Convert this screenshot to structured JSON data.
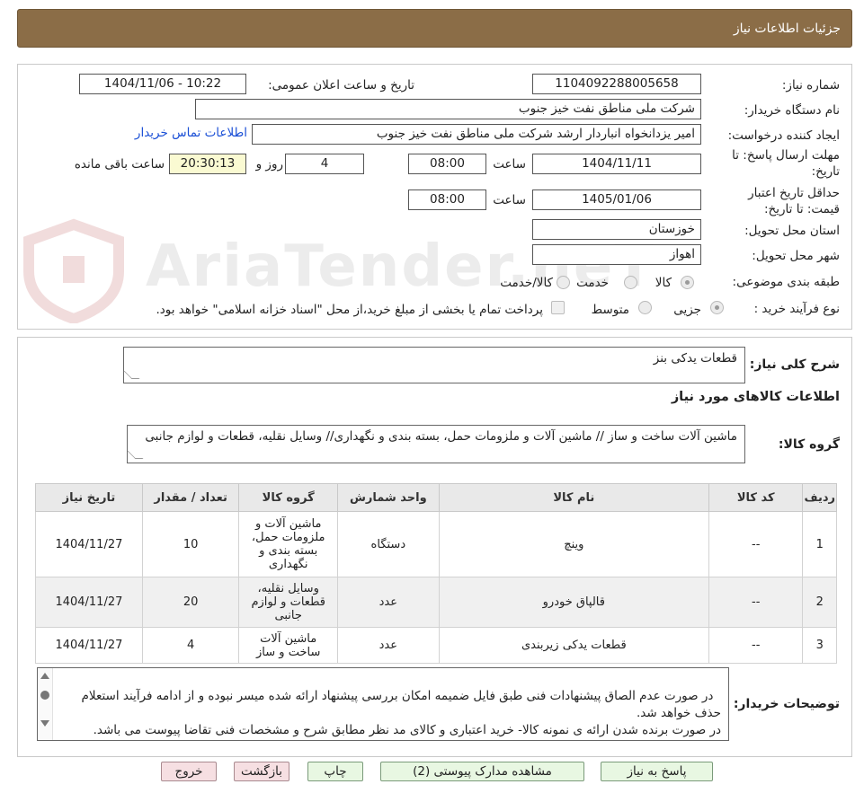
{
  "header": {
    "title": "جزئیات اطلاعات نیاز"
  },
  "watermark": {
    "text": "AriaTender.neT"
  },
  "fields": {
    "need_number_label": "شماره نیاز:",
    "need_number": "1104092288005658",
    "announce_label": "تاریخ و ساعت اعلان عمومی:",
    "announce_value": "1404/11/06 - 10:22",
    "buyer_label": "نام دستگاه خریدار:",
    "buyer_value": "شرکت ملی مناطق نفت خیز جنوب",
    "creator_label": "ایجاد کننده درخواست:",
    "creator_value": "امیر یزدانخواه انباردار ارشد شرکت ملی مناطق نفت خیز جنوب",
    "contact_link": "اطلاعات تماس خریدار",
    "deadline_label": "مهلت ارسال پاسخ: تا تاریخ:",
    "deadline_date": "1404/11/11",
    "time_label": "ساعت",
    "deadline_time": "08:00",
    "days_value": "4",
    "days_label": "روز و",
    "remaining_time": "20:30:13",
    "remaining_label": "ساعت باقی مانده",
    "validity_label": "حداقل تاریخ اعتبار قیمت: تا تاریخ:",
    "validity_date": "1405/01/06",
    "validity_time": "08:00",
    "province_label": "استان محل تحویل:",
    "province_value": "خوزستان",
    "city_label": "شهر محل تحویل:",
    "city_value": "اهواز",
    "category_label": "طبقه بندی موضوعی:",
    "category_options": [
      "کالا",
      "خدمت",
      "کالا/خدمت"
    ],
    "process_label": "نوع فرآیند خرید :",
    "process_options": [
      "جزیی",
      "متوسط"
    ],
    "payment_note": "پرداخت تمام یا بخشی از مبلغ خرید،از محل \"اسناد خزانه اسلامی\" خواهد بود."
  },
  "summary": {
    "label": "شرح کلی نیاز:",
    "value": "قطعات یدکی بنز",
    "goods_info_title": "اطلاعات کالاهای مورد نیاز",
    "group_label": "گروه کالا:",
    "group_value": "ماشین آلات ساخت و ساز // ماشین آلات و ملزومات حمل، بسته بندی و نگهداری// وسایل نقلیه، قطعات و لوازم جانبی"
  },
  "table": {
    "headers": [
      "ردیف",
      "کد کالا",
      "نام کالا",
      "واحد شمارش",
      "گروه کالا",
      "تعداد / مقدار",
      "تاریخ نیاز"
    ],
    "rows": [
      [
        "1",
        "--",
        "وینچ",
        "دستگاه",
        "ماشین آلات و ملزومات حمل، بسته بندی و نگهداری",
        "10",
        "1404/11/27"
      ],
      [
        "2",
        "--",
        "قالپاق خودرو",
        "عدد",
        "وسایل نقلیه، قطعات و لوازم جانبی",
        "20",
        "1404/11/27"
      ],
      [
        "3",
        "--",
        "قطعات یدکی زیربندی",
        "عدد",
        "ماشین آلات ساخت و ساز",
        "4",
        "1404/11/27"
      ]
    ]
  },
  "buyer_notes": {
    "label": "توضیحات خریدار:",
    "text": "در صورت عدم الصاق پیشنهادات فنی طبق فایل ضمیمه امکان بررسی پیشنهاد ارائه شده میسر نبوده و از ادامه فرآیند استعلام حذف خواهد شد.\nدر صورت برنده شدن ارائه ی نمونه کالا- خرید اعتباری و کالای مد نظر مطابق شرح و مشخصات فنی تقاضا پیوست می باشد."
  },
  "buttons": {
    "reply": "پاسخ به نیاز",
    "attachments": "مشاهده مدارک پیوستی (2)",
    "print": "چاپ",
    "back": "بازگشت",
    "exit": "خروج"
  },
  "colors": {
    "header_bg": "#8b6d47",
    "button_green": "#e8f7e2",
    "button_red": "#f6dfe2",
    "link": "#1a4fd6"
  }
}
